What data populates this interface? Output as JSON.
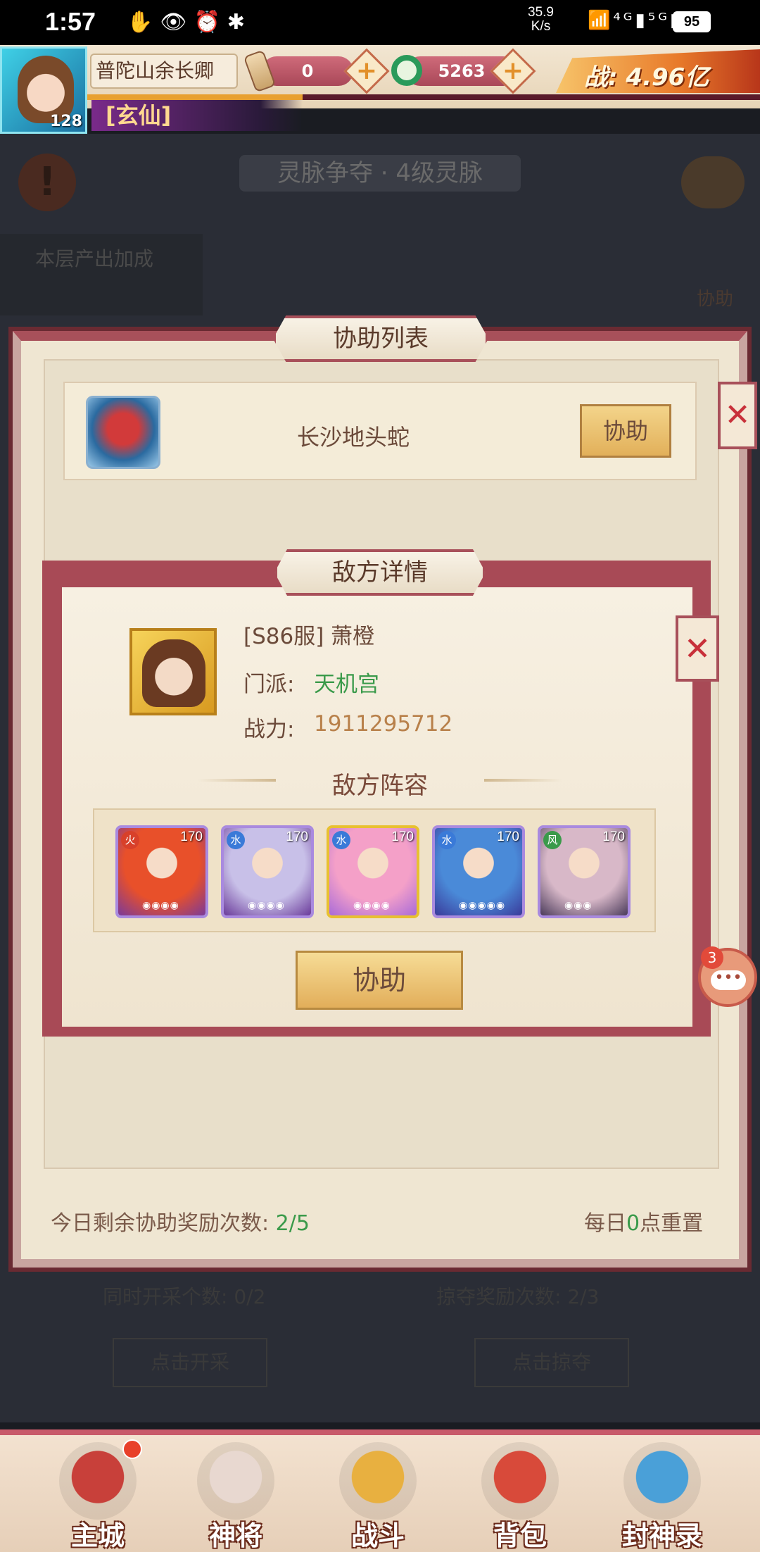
{
  "status_bar": {
    "time": "1:57",
    "left_icons": "✋👁⏰✱",
    "speed_value": "35.9",
    "speed_unit": "K/s",
    "signal_icons": "📶⁴ᴳ▮⁵ᴳ▮",
    "battery": "95"
  },
  "hud": {
    "player_name": "普陀山余长卿",
    "level": "128",
    "title_badge": "[玄仙]",
    "resource_scroll": "0",
    "resource_jade": "5263",
    "plus_label": "+",
    "power": "战: 4.96亿",
    "exp_progress": 0.32
  },
  "background": {
    "title": "灵脉争夺 · 4级灵脉",
    "alert_icon": "!",
    "bonus_label": "本层产出加成",
    "help_label": "协助",
    "lower_left": "同时开采个数: 0/2",
    "lower_right": "掠夺奖励次数: 2/3",
    "btn_mine": "点击开采",
    "btn_plunder": "点击掠夺"
  },
  "assist_list": {
    "title": "协助列表",
    "close_label": "✕",
    "item": {
      "name": "长沙地头蛇",
      "button": "协助"
    },
    "footer_left_label": "今日剩余协助奖励次数: ",
    "footer_left_value": "2/5",
    "footer_right_pre": "每日",
    "footer_right_value": "0",
    "footer_right_post": "点重置"
  },
  "enemy_detail": {
    "title": "敌方详情",
    "close_label": "✕",
    "name": "[S86服] 萧橙",
    "sect_label": "门派:",
    "sect_value": "天机宫",
    "power_label": "战力:",
    "power_value": "1911295712",
    "lineup_title": "敌方阵容",
    "heroes": [
      {
        "level": "170",
        "element": "火",
        "element_color": "#d8402a",
        "stars": "◉◉◉◉",
        "colors": [
          "#e8502a",
          "#7a3a9a"
        ]
      },
      {
        "level": "170",
        "element": "水",
        "element_color": "#3a7ad8",
        "stars": "◉◉◉◉",
        "colors": [
          "#c8c0e8",
          "#6a3a9a"
        ]
      },
      {
        "level": "170",
        "element": "水",
        "element_color": "#3a7ad8",
        "stars": "◉◉◉◉",
        "colors": [
          "#f4a0c8",
          "#a86ad8"
        ]
      },
      {
        "level": "170",
        "element": "水",
        "element_color": "#3a7ad8",
        "stars": "◉◉◉◉◉",
        "colors": [
          "#4a8ad8",
          "#3a3a9a"
        ]
      },
      {
        "level": "170",
        "element": "风",
        "element_color": "#3a9a4a",
        "stars": "◉◉◉",
        "colors": [
          "#d8b8c8",
          "#4a3a5a"
        ]
      }
    ],
    "assist_button": "协助"
  },
  "chat": {
    "badge": "3",
    "icon": "chat-bubble-icon",
    "dots": "•••"
  },
  "nav": [
    {
      "label": "主城",
      "icon": "city-gate-icon",
      "color": "#c8403a"
    },
    {
      "label": "神将",
      "icon": "general-icon",
      "color": "#e8d8d0"
    },
    {
      "label": "战斗",
      "icon": "crossed-swords-icon",
      "color": "#e8b040"
    },
    {
      "label": "背包",
      "icon": "bag-icon",
      "color": "#d84a3a"
    },
    {
      "label": "封神录",
      "icon": "scroll-book-icon",
      "color": "#4aa0d8"
    }
  ]
}
